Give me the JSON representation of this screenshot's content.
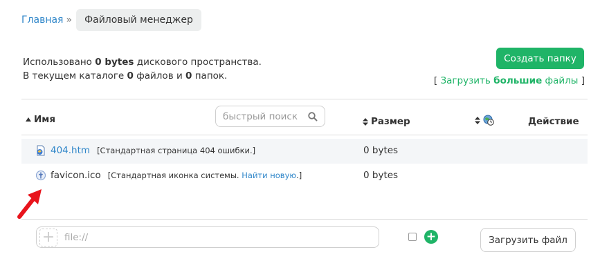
{
  "breadcrumb": {
    "home": "Главная",
    "separator": "»",
    "current": "Файловый менеджер"
  },
  "usage": {
    "line1_prefix": "Использовано",
    "used": "0 bytes",
    "line1_suffix": "дискового пространства.",
    "line2_prefix": "В текущем каталоге",
    "files_count": "0",
    "line2_mid": "файлов и",
    "folders_count": "0",
    "line2_suffix": "папок."
  },
  "actions": {
    "create_folder": "Создать папку",
    "upload_bracket_open": "[",
    "upload_prefix": "Загрузить",
    "upload_bold": "большие",
    "upload_suffix": "файлы",
    "upload_bracket_close": "]"
  },
  "table": {
    "headers": {
      "name": "Имя",
      "size": "Размер",
      "action": "Действие"
    },
    "search_placeholder": "быстрый поиск",
    "rows": [
      {
        "name": "404.htm",
        "desc_prefix": "[Стандартная страница 404 ошибки.]",
        "desc_link": "",
        "desc_suffix": "",
        "size": "0 bytes",
        "icon": "html-file-icon"
      },
      {
        "name": "favicon.ico",
        "desc_prefix": "[Стандартная иконка системы.",
        "desc_link": "Найти новую",
        "desc_suffix": ".]",
        "size": "0 bytes",
        "icon": "favicon-file-icon"
      }
    ]
  },
  "footer": {
    "file_placeholder": "file://",
    "upload_button": "Загрузить файл"
  },
  "colors": {
    "accent_green": "#1fb467",
    "link_blue": "#2f86c9",
    "arrow_red": "#e8141c"
  }
}
